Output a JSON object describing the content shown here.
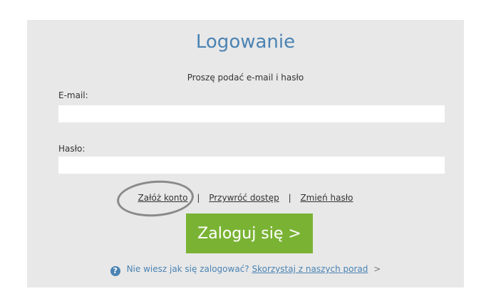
{
  "login": {
    "title": "Logowanie",
    "subtitle": "Proszę podać e-mail i hasło",
    "email_label": "E-mail:",
    "email_value": "",
    "password_label": "Hasło:",
    "password_value": "",
    "submit_label": "Zaloguj się >"
  },
  "links": {
    "create_account": "Załóż konto",
    "separator": "|",
    "restore_access": "Przywróć dostęp",
    "change_password": "Zmień hasło"
  },
  "help": {
    "icon": "question-circle-icon",
    "icon_glyph": "?",
    "text": "Nie wiesz jak się zalogować?",
    "link": "Skorzystaj z naszych porad",
    "arrow": ">"
  },
  "colors": {
    "panel_bg": "#e8e8e8",
    "title": "#4a83b3",
    "button_bg": "#7ab334",
    "annotation_circle": "#8a8a8a"
  }
}
